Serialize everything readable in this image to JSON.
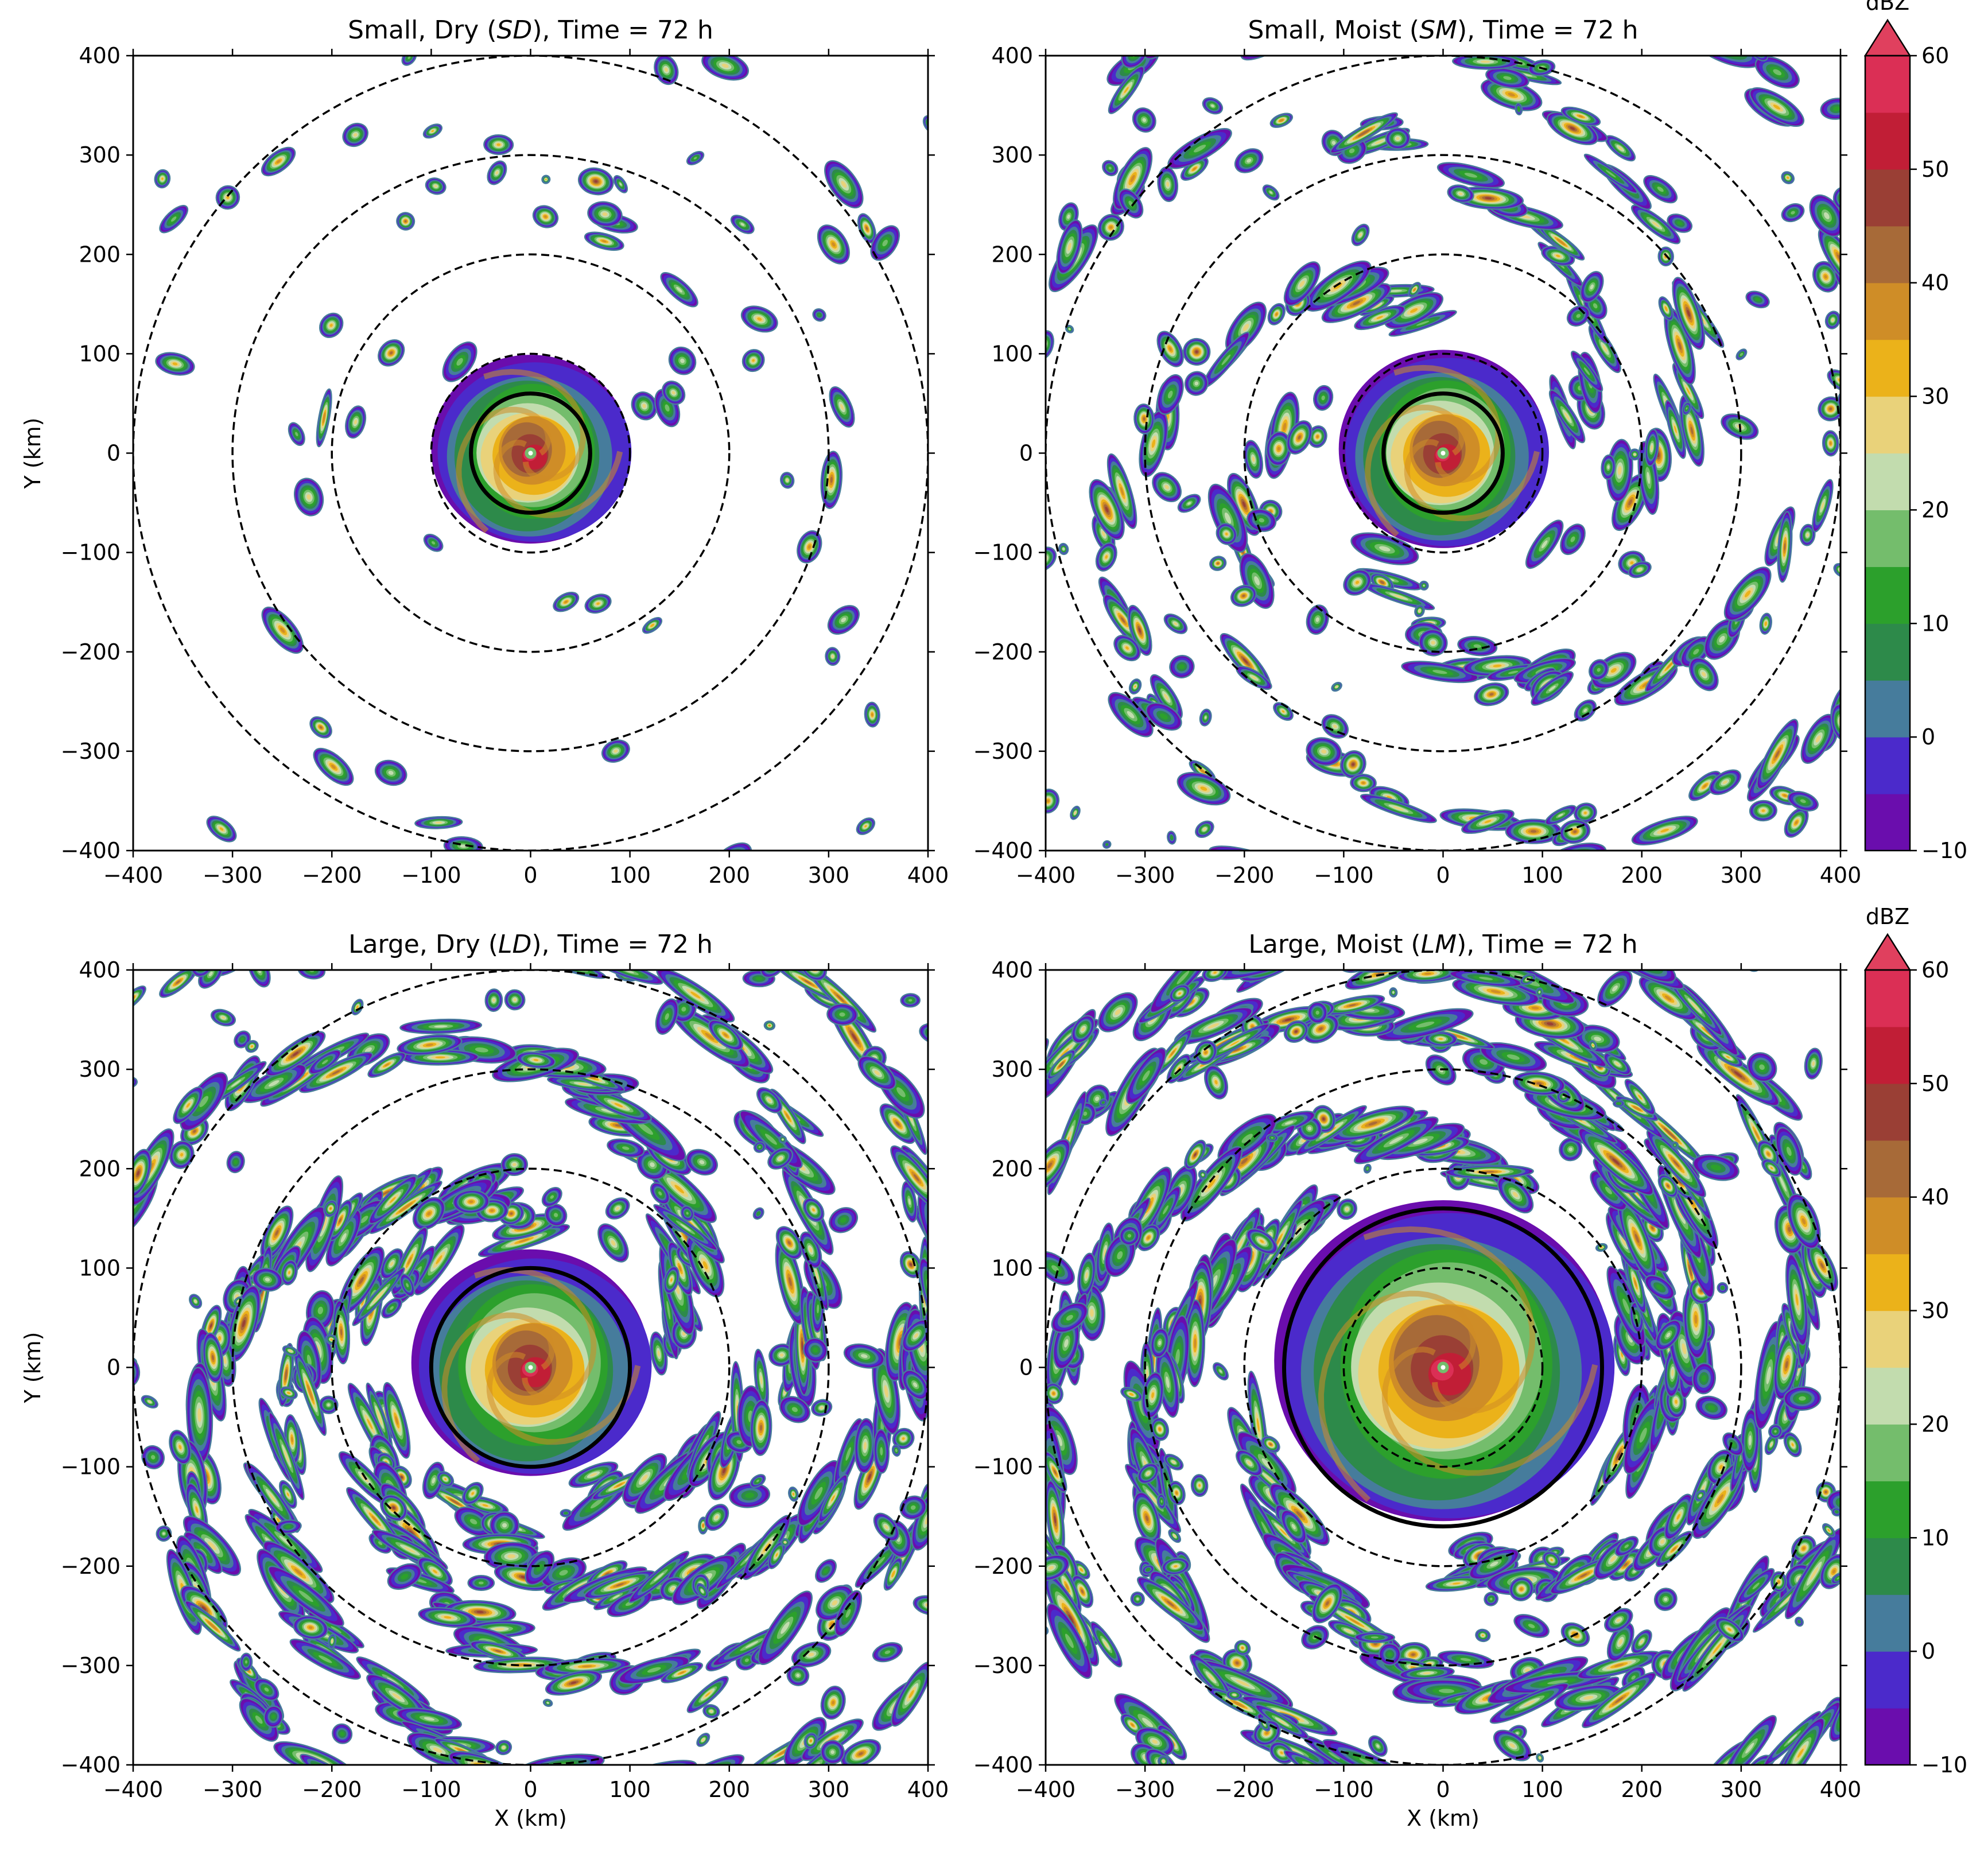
{
  "chart_data": [
    {
      "type": "heatmap",
      "title": "Small, Dry (SD), Time = 72 h",
      "title_parts": {
        "pre": "Small, Dry (",
        "italic": "SD",
        "post": "), Time = 72 h"
      },
      "xlabel": "",
      "ylabel": "Y (km)",
      "xlim": [
        -400,
        400
      ],
      "ylim": [
        -400,
        400
      ],
      "xticks": [
        "−400",
        "−300",
        "−200",
        "−100",
        "0",
        "100",
        "200",
        "300",
        "400"
      ],
      "yticks": [
        "−400",
        "−300",
        "−200",
        "−100",
        "0",
        "100",
        "200",
        "300",
        "400"
      ],
      "dashed_circle_radii_km": [
        100,
        200,
        300,
        400
      ],
      "solid_circle_radius_km": 60,
      "field": "reflectivity",
      "core_extent_km": 100,
      "convection_density": 0.25,
      "band_strength": 0.15,
      "seed": 11
    },
    {
      "type": "heatmap",
      "title": "Small, Moist (SM), Time = 72 h",
      "title_parts": {
        "pre": "Small, Moist (",
        "italic": "SM",
        "post": "), Time = 72 h"
      },
      "xlabel": "",
      "ylabel": "",
      "xlim": [
        -400,
        400
      ],
      "ylim": [
        -400,
        400
      ],
      "xticks": [
        "−400",
        "−300",
        "−200",
        "−100",
        "0",
        "100",
        "200",
        "300",
        "400"
      ],
      "yticks": [
        "−400",
        "−300",
        "−200",
        "−100",
        "0",
        "100",
        "200",
        "300",
        "400"
      ],
      "dashed_circle_radii_km": [
        100,
        200,
        300,
        400
      ],
      "solid_circle_radius_km": 60,
      "field": "reflectivity",
      "core_extent_km": 105,
      "convection_density": 0.6,
      "band_strength": 0.55,
      "seed": 23
    },
    {
      "type": "heatmap",
      "title": "Large, Dry (LD), Time = 72 h",
      "title_parts": {
        "pre": "Large, Dry (",
        "italic": "LD",
        "post": "), Time = 72 h"
      },
      "xlabel": "X (km)",
      "ylabel": "Y (km)",
      "xlim": [
        -400,
        400
      ],
      "ylim": [
        -400,
        400
      ],
      "xticks": [
        "−400",
        "−300",
        "−200",
        "−100",
        "0",
        "100",
        "200",
        "300",
        "400"
      ],
      "yticks": [
        "−400",
        "−300",
        "−200",
        "−100",
        "0",
        "100",
        "200",
        "300",
        "400"
      ],
      "dashed_circle_radii_km": [
        100,
        200,
        300,
        400
      ],
      "solid_circle_radius_km": 100,
      "field": "reflectivity",
      "core_extent_km": 120,
      "convection_density": 0.85,
      "band_strength": 0.85,
      "seed": 37
    },
    {
      "type": "heatmap",
      "title": "Large, Moist (LM), Time = 72 h",
      "title_parts": {
        "pre": "Large, Moist (",
        "italic": "LM",
        "post": "), Time = 72 h"
      },
      "xlabel": "X (km)",
      "ylabel": "",
      "xlim": [
        -400,
        400
      ],
      "ylim": [
        -400,
        400
      ],
      "xticks": [
        "−400",
        "−300",
        "−200",
        "−100",
        "0",
        "100",
        "200",
        "300",
        "400"
      ],
      "yticks": [
        "−400",
        "−300",
        "−200",
        "−100",
        "0",
        "100",
        "200",
        "300",
        "400"
      ],
      "dashed_circle_radii_km": [
        100,
        200,
        300,
        400
      ],
      "solid_circle_radius_km": 160,
      "field": "reflectivity",
      "core_extent_km": 170,
      "convection_density": 0.95,
      "band_strength": 1.0,
      "seed": 53
    }
  ],
  "colorbar": {
    "label": "dBZ",
    "min": -10,
    "max": 60,
    "step": 5,
    "extend": "max",
    "tick_values": [
      -10,
      0,
      10,
      20,
      30,
      40,
      50,
      60
    ],
    "tick_labels": [
      "−10",
      "0",
      "10",
      "20",
      "30",
      "40",
      "50",
      "60"
    ],
    "colors": [
      "#6a0dad",
      "#4b2acb",
      "#467c9c",
      "#2d8a4a",
      "#2ca02c",
      "#74bd6c",
      "#c2dcae",
      "#e9d27a",
      "#ebb21a",
      "#cf8d27",
      "#a76a38",
      "#9a3f35",
      "#c11e36",
      "#db2f55"
    ],
    "extend_color": "#e0405e"
  }
}
